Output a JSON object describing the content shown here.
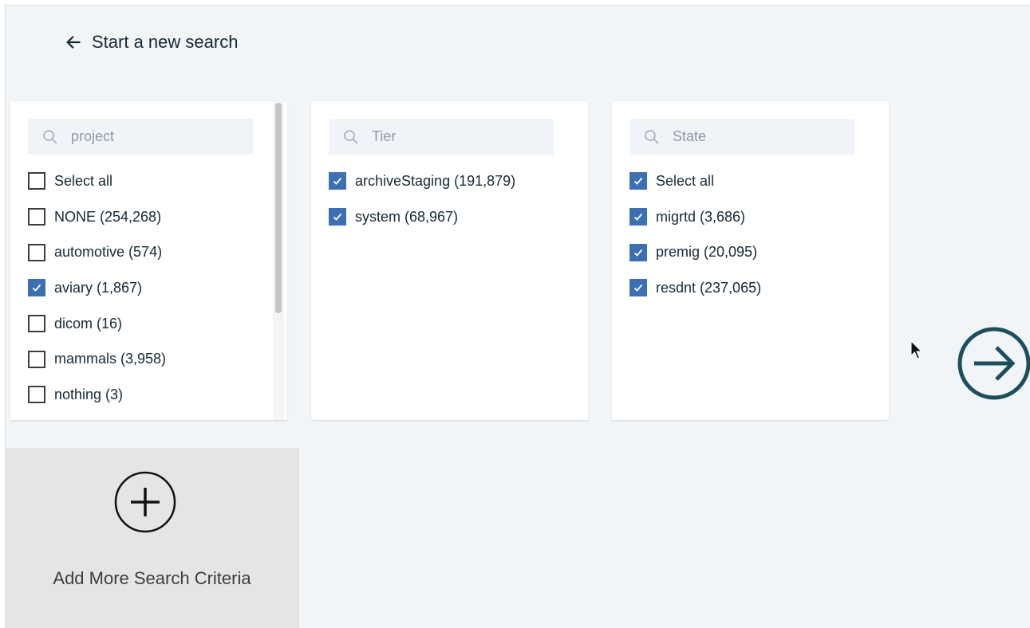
{
  "back": {
    "label": "Start a new search",
    "icon": "arrow-left-icon"
  },
  "panels": [
    {
      "search_placeholder": "project",
      "items": [
        {
          "label": "Select all",
          "checked": false
        },
        {
          "label": "NONE (254,268)",
          "checked": false
        },
        {
          "label": "automotive (574)",
          "checked": false
        },
        {
          "label": "aviary (1,867)",
          "checked": true
        },
        {
          "label": "dicom (16)",
          "checked": false
        },
        {
          "label": "mammals (3,958)",
          "checked": false
        },
        {
          "label": "nothing (3)",
          "checked": false
        }
      ]
    },
    {
      "search_placeholder": "Tier",
      "items": [
        {
          "label": "archiveStaging (191,879)",
          "checked": true
        },
        {
          "label": "system (68,967)",
          "checked": true
        }
      ]
    },
    {
      "search_placeholder": "State",
      "items": [
        {
          "label": "Select all",
          "checked": true
        },
        {
          "label": "migrtd (3,686)",
          "checked": true
        },
        {
          "label": "premig (20,095)",
          "checked": true
        },
        {
          "label": "resdnt (237,065)",
          "checked": true
        }
      ]
    }
  ],
  "add_more": {
    "label": "Add More Search Criteria",
    "icon": "plus-circle-icon"
  },
  "next": {
    "icon": "arrow-right-circle-icon"
  },
  "colors": {
    "background": "#f1f5f8",
    "checkbox_checked": "#3d70b2",
    "next_button": "#1d4e5c",
    "add_tile": "#e5e5e5"
  }
}
